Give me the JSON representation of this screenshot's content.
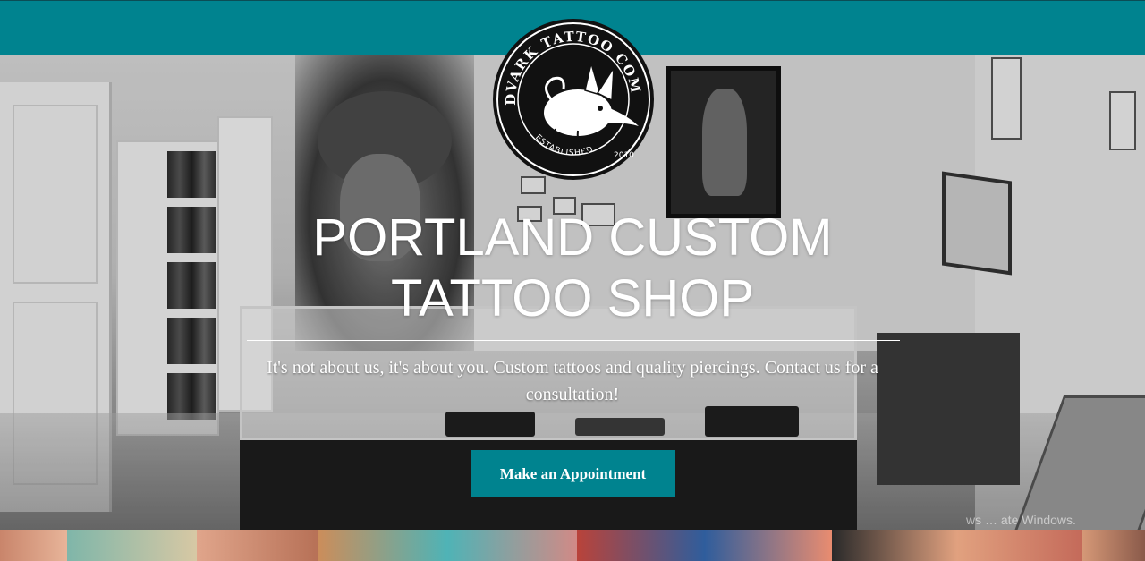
{
  "brand": {
    "logo_text": "AARDVARK TATTOO COMPANY",
    "logo_established": "ESTABLISHED",
    "logo_year": "2010",
    "accent_color": "#00838f"
  },
  "hero": {
    "headline": "PORTLAND CUSTOM TATTOO SHOP",
    "tagline": "It's not about us, it's about you. Custom tattoos and quality piercings.  Contact us for a consultation!",
    "cta_label": "Make an Appointment"
  },
  "overlay": {
    "watermark": "ws … ate Windows."
  }
}
